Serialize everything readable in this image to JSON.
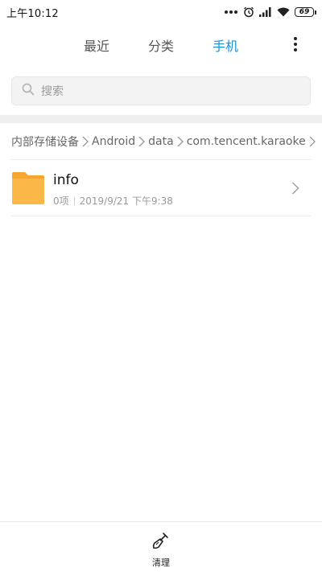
{
  "status_bar": {
    "time": "上午10:12",
    "battery_level": "69",
    "icons": [
      "dots-icon",
      "alarm-icon",
      "signal-icon",
      "wifi-icon",
      "battery-icon"
    ]
  },
  "top_tabs": {
    "items": [
      {
        "label": "最近",
        "active": false
      },
      {
        "label": "分类",
        "active": false
      },
      {
        "label": "手机",
        "active": true
      }
    ],
    "active_color": "#1e90d8",
    "more_icon": "more-vertical-icon"
  },
  "search": {
    "placeholder": "搜索",
    "icon": "search-icon"
  },
  "breadcrumb": {
    "items": [
      "内部存储设备",
      "Android",
      "data",
      "com.tencent.karaoke"
    ]
  },
  "files": [
    {
      "name": "info",
      "item_count": "0项",
      "modified": "2019/9/21 下午9:38",
      "icon": "folder-icon",
      "icon_color": "#fbb846"
    }
  ],
  "bottom_bar": {
    "clean_label": "清理",
    "clean_icon": "broom-icon"
  }
}
